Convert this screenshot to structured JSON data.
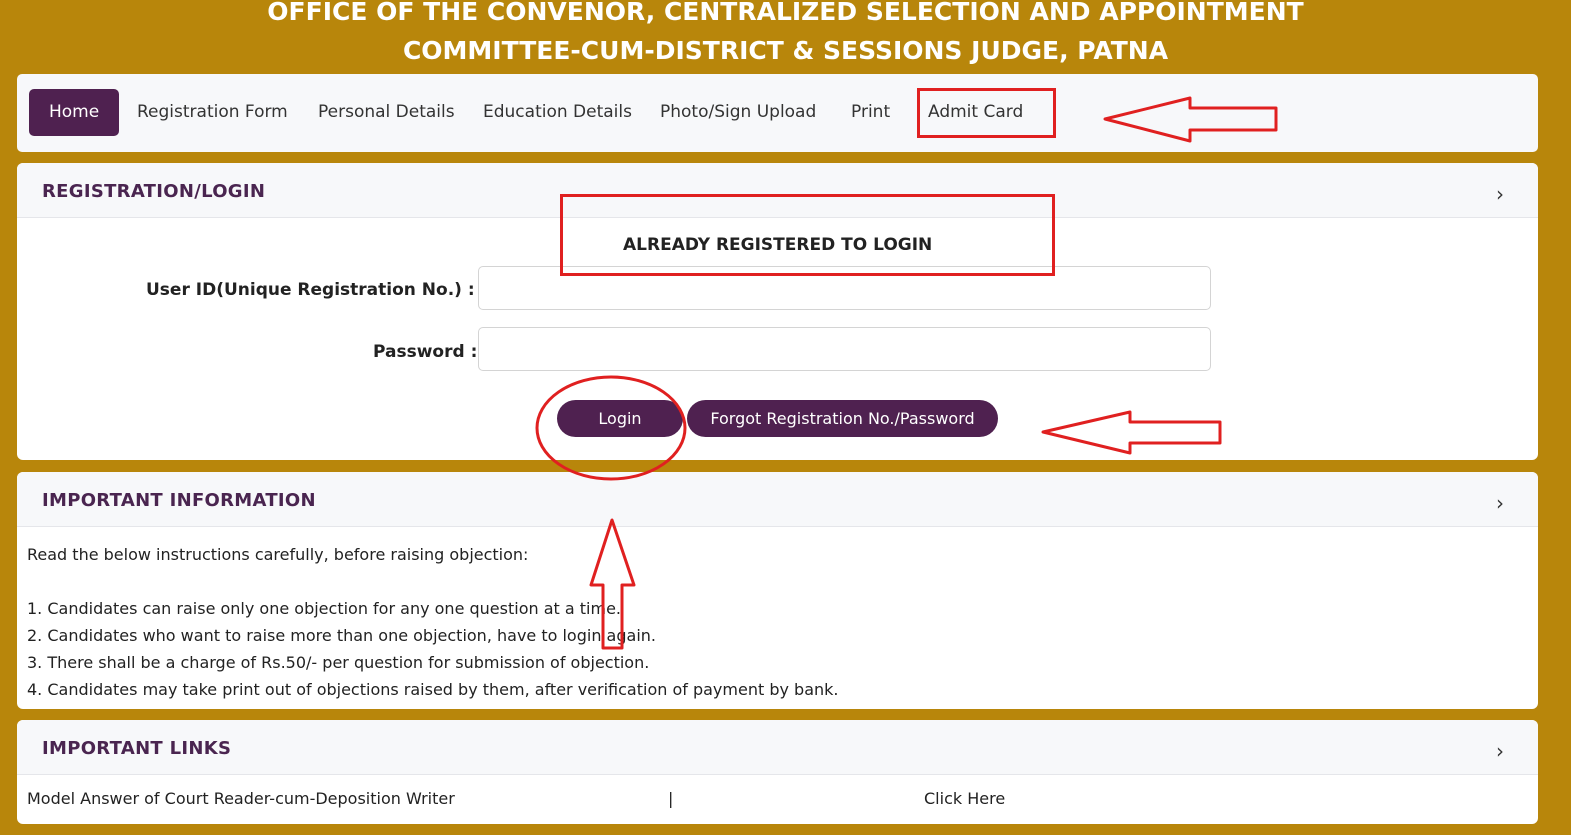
{
  "header": {
    "line1": "OFFICE OF THE CONVENOR, CENTRALIZED SELECTION AND APPOINTMENT",
    "line2": "COMMITTEE-CUM-DISTRICT & SESSIONS JUDGE, PATNA"
  },
  "nav": {
    "items": [
      "Home",
      "Registration Form",
      "Personal Details",
      "Education Details",
      "Photo/Sign Upload",
      "Print",
      "Admit Card"
    ],
    "active": "Home"
  },
  "login": {
    "title": "REGISTRATION/LOGIN",
    "heading": "ALREADY REGISTERED TO LOGIN",
    "userid_label": "User ID(Unique Registration No.) :",
    "userid_value": "",
    "password_label": "Password :",
    "password_value": "",
    "login_button": "Login",
    "forgot_button": "Forgot Registration No./Password"
  },
  "info": {
    "title": "IMPORTANT INFORMATION",
    "intro": "Read the below instructions carefully, before raising objection:",
    "items": [
      "1. Candidates can raise only one objection for any one question at a time.",
      "2. Candidates who want to raise more than one objection, have to login again.",
      "3. There shall be a charge of Rs.50/- per question for submission of objection.",
      "4. Candidates may take print out of objections raised by them, after verification of payment by bank."
    ]
  },
  "links": {
    "title": "IMPORTANT LINKS",
    "rows": [
      {
        "name": "Model Answer of Court Reader-cum-Deposition Writer",
        "separator": "|",
        "link": "Click Here"
      }
    ]
  },
  "icons": {
    "panel_toggle": "chevron-right-icon",
    "chevron_glyph": "›"
  },
  "colors": {
    "page_bg": "#b8860b",
    "accent": "#4f2150",
    "panel_title": "#4a2550",
    "annotation": "#e02020"
  }
}
